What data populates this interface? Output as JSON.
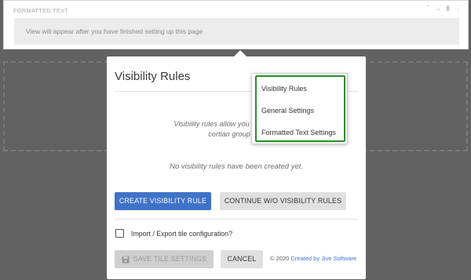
{
  "tile": {
    "header": "FORMATTED TEXT",
    "placeholder": "View will appear after you have finished setting up this page",
    "controls": {
      "collapse_icon": "chevron-up-icon",
      "expand_icon": "chevron-down-icon",
      "delete_icon": "trash-icon",
      "menu_icon": "more-vertical-icon"
    }
  },
  "modal": {
    "title": "Visibility Rules",
    "description": "Visibility rules allow you to configure co... certian group of p...",
    "description_line1": "Visibility rules allow you to configure co",
    "description_line2": "certian group of p",
    "empty_state": "No visibility rules have been created yet.",
    "create_button": "CREATE VISIBILITY RULE",
    "continue_button": "CONTINUE W/O VISIBILITY RULES",
    "import_export_label": "Import / Export tile configuration?",
    "import_export_checked": false,
    "save_button": "SAVE TILE SETTINGS",
    "save_enabled": false,
    "cancel_button": "CANCEL",
    "footer_copyright": "© 2020",
    "footer_link": "Created by Jive Software"
  },
  "menu": {
    "items": [
      {
        "label": "Visibility Rules"
      },
      {
        "label": "General Settings"
      },
      {
        "label": "Formatted Text Settings"
      }
    ]
  },
  "colors": {
    "primary": "#3f73c7",
    "highlight": "#2e8b2e",
    "overlay": "#626262"
  }
}
